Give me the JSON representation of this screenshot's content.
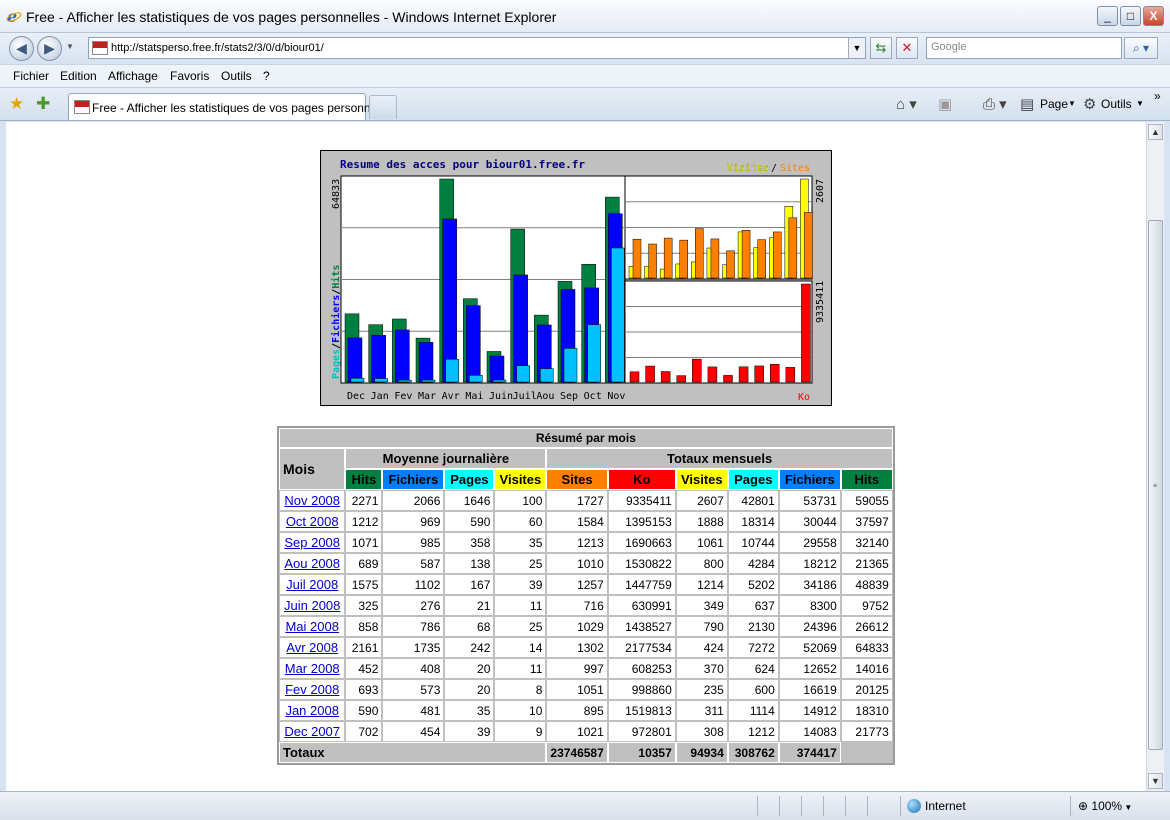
{
  "window": {
    "title": "Free - Afficher les statistiques de vos pages personnelles - Windows Internet Explorer",
    "minimize": "_",
    "maximize": "□",
    "close": "X"
  },
  "address": {
    "url": "http://statsperso.free.fr/stats2/3/0/d/biour01/",
    "search_placeholder": "Google"
  },
  "menu": [
    "Fichier",
    "Edition",
    "Affichage",
    "Favoris",
    "Outils",
    "?"
  ],
  "tab": {
    "label": "Free - Afficher les statistiques de vos pages personne..."
  },
  "commands": {
    "page": "Page",
    "tools": "Outils"
  },
  "status": {
    "zone": "Internet",
    "zoom": "100%"
  },
  "colors": {
    "hits": "#008040",
    "files": "#0080ff",
    "pages": "#00ffff",
    "visits": "#ffff00",
    "sites": "#ff8000",
    "kbytes": "#ff0000"
  },
  "chart_data": {
    "type": "bar",
    "title": "Resume des acces pour biour01.free.fr",
    "legend_right": {
      "visits": "Visites",
      "sep": "/",
      "sites": "Sites"
    },
    "legend_left": {
      "pages": "Pages",
      "sep1": "/",
      "files": "Fichiers",
      "sep2": "/",
      "hits": "Hits"
    },
    "max_hits_label": "64833",
    "max_visits_label": "2607",
    "max_kb_label": "9335411",
    "kb_label": "Ko",
    "categories": [
      "Dec",
      "Jan",
      "Fev",
      "Mar",
      "Avr",
      "Mai",
      "Juin",
      "Juil",
      "Aou",
      "Sep",
      "Oct",
      "Nov"
    ],
    "series": [
      {
        "name": "Hits",
        "values": [
          21773,
          18310,
          20125,
          14016,
          64833,
          26612,
          9752,
          48839,
          21365,
          32140,
          37597,
          59055
        ]
      },
      {
        "name": "Fichiers",
        "values": [
          14083,
          14912,
          16619,
          12652,
          52069,
          24396,
          8300,
          34186,
          18212,
          29558,
          30044,
          53731
        ]
      },
      {
        "name": "Pages",
        "values": [
          1212,
          1114,
          600,
          624,
          7272,
          2130,
          637,
          5202,
          4284,
          10744,
          18314,
          42801
        ]
      },
      {
        "name": "Visites",
        "values": [
          308,
          311,
          235,
          370,
          424,
          790,
          349,
          1214,
          800,
          1061,
          1888,
          2607
        ]
      },
      {
        "name": "Sites",
        "values": [
          1021,
          895,
          1051,
          997,
          1302,
          1029,
          716,
          1257,
          1010,
          1213,
          1584,
          1727
        ]
      },
      {
        "name": "Ko",
        "values": [
          972801,
          1519813,
          998860,
          608253,
          2177534,
          1438527,
          630991,
          1447759,
          1530822,
          1690663,
          1395153,
          9335411
        ]
      }
    ]
  },
  "table": {
    "title": "Résumé par mois",
    "col_month": "Mois",
    "group_daily": "Moyenne journalière",
    "group_monthly": "Totaux mensuels",
    "daily_headers": [
      "Hits",
      "Fichiers",
      "Pages",
      "Visites"
    ],
    "monthly_headers": [
      "Sites",
      "Ko",
      "Visites",
      "Pages",
      "Fichiers",
      "Hits"
    ],
    "rows": [
      {
        "month": "Nov 2008",
        "cells": [
          "2271",
          "2066",
          "1646",
          "100",
          "1727",
          "9335411",
          "2607",
          "42801",
          "53731",
          "59055"
        ]
      },
      {
        "month": "Oct 2008",
        "cells": [
          "1212",
          "969",
          "590",
          "60",
          "1584",
          "1395153",
          "1888",
          "18314",
          "30044",
          "37597"
        ]
      },
      {
        "month": "Sep 2008",
        "cells": [
          "1071",
          "985",
          "358",
          "35",
          "1213",
          "1690663",
          "1061",
          "10744",
          "29558",
          "32140"
        ]
      },
      {
        "month": "Aou 2008",
        "cells": [
          "689",
          "587",
          "138",
          "25",
          "1010",
          "1530822",
          "800",
          "4284",
          "18212",
          "21365"
        ]
      },
      {
        "month": "Juil 2008",
        "cells": [
          "1575",
          "1102",
          "167",
          "39",
          "1257",
          "1447759",
          "1214",
          "5202",
          "34186",
          "48839"
        ]
      },
      {
        "month": "Juin 2008",
        "cells": [
          "325",
          "276",
          "21",
          "11",
          "716",
          "630991",
          "349",
          "637",
          "8300",
          "9752"
        ]
      },
      {
        "month": "Mai 2008",
        "cells": [
          "858",
          "786",
          "68",
          "25",
          "1029",
          "1438527",
          "790",
          "2130",
          "24396",
          "26612"
        ]
      },
      {
        "month": "Avr 2008",
        "cells": [
          "2161",
          "1735",
          "242",
          "14",
          "1302",
          "2177534",
          "424",
          "7272",
          "52069",
          "64833"
        ]
      },
      {
        "month": "Mar 2008",
        "cells": [
          "452",
          "408",
          "20",
          "11",
          "997",
          "608253",
          "370",
          "624",
          "12652",
          "14016"
        ]
      },
      {
        "month": "Fev 2008",
        "cells": [
          "693",
          "573",
          "20",
          "8",
          "1051",
          "998860",
          "235",
          "600",
          "16619",
          "20125"
        ]
      },
      {
        "month": "Jan 2008",
        "cells": [
          "590",
          "481",
          "35",
          "10",
          "895",
          "1519813",
          "311",
          "1114",
          "14912",
          "18310"
        ]
      },
      {
        "month": "Dec 2007",
        "cells": [
          "702",
          "454",
          "39",
          "9",
          "1021",
          "972801",
          "308",
          "1212",
          "14083",
          "21773"
        ]
      }
    ],
    "totals_label": "Totaux",
    "totals": [
      "23746587",
      "10357",
      "94934",
      "308762",
      "374417"
    ]
  }
}
